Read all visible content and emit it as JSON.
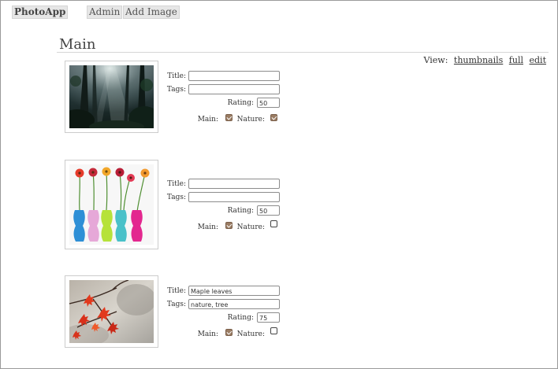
{
  "nav": {
    "logo": "PhotoApp",
    "admin": "Admin",
    "add_image": "Add Image"
  },
  "page_title": "Main",
  "view": {
    "label": "View:",
    "thumbnails": "thumbnails",
    "full": "full",
    "edit": "edit"
  },
  "labels": {
    "title": "Title:",
    "tags": "Tags:",
    "rating": "Rating:",
    "main": "Main:",
    "nature": "Nature:"
  },
  "photos": [
    {
      "image": "forest-sunbeams",
      "title": "",
      "tags": "",
      "rating": "50",
      "main": true,
      "nature": true
    },
    {
      "image": "gerbera-vases",
      "title": "",
      "tags": "",
      "rating": "50",
      "main": true,
      "nature": false
    },
    {
      "image": "maple-leaves",
      "title": "Maple leaves",
      "tags": "nature, tree",
      "rating": "75",
      "main": true,
      "nature": false
    }
  ],
  "colors": {
    "checkbox_checked": "#9a7c63",
    "nav_bg": "#e6e6e6"
  }
}
